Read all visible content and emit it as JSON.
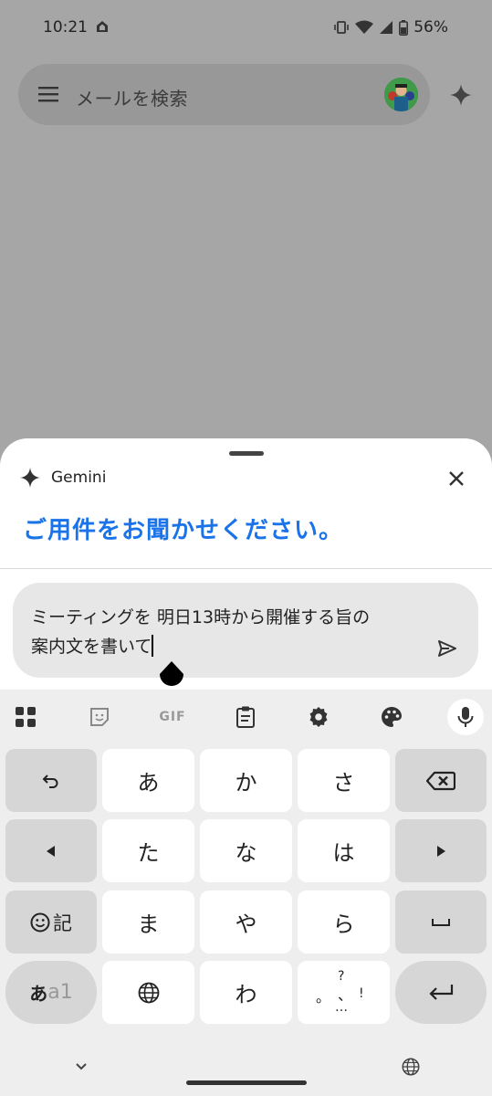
{
  "status_bar": {
    "time": "10:21",
    "battery": "56%"
  },
  "search": {
    "placeholder": "メールを検索"
  },
  "gemini_sheet": {
    "app_name": "Gemini",
    "prompt_title": "ご用件をお聞かせください。",
    "input_line1": "ミーティングを 明日13時から開催する旨の",
    "input_line2": "案内文を書いて",
    "accent_color": "#1a73e8"
  },
  "keyboard": {
    "toolbar": [
      "apps-grid-icon",
      "sticker-icon",
      "GIF",
      "clipboard-icon",
      "settings-icon",
      "palette-icon",
      "mic-icon"
    ],
    "gif_label": "GIF",
    "row1": {
      "undo": "↶",
      "k1": "あ",
      "k2": "か",
      "k3": "さ"
    },
    "row2": {
      "left": "◀",
      "k1": "た",
      "k2": "な",
      "k3": "は",
      "right": "▶"
    },
    "row3": {
      "emoji_label": "記",
      "k1": "ま",
      "k2": "や",
      "k3": "ら",
      "space": "␣"
    },
    "row4": {
      "mode_a": "あ",
      "mode_b": "a1",
      "k2": "わ",
      "punct_q": "?",
      "punct_comma": "、",
      "punct_period": "。",
      "punct_excl": "!",
      "punct_dots": "…"
    }
  }
}
